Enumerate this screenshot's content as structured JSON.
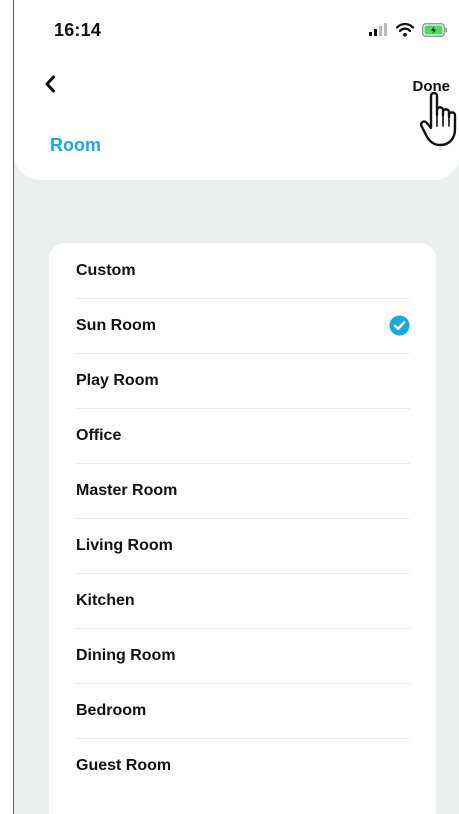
{
  "status_bar": {
    "time": "16:14",
    "icons": [
      "cellular-signal-icon",
      "wifi-icon",
      "battery-charging-icon"
    ]
  },
  "nav": {
    "back_icon": "chevron-left-icon",
    "done_label": "Done"
  },
  "page_title": "Room",
  "rooms": [
    {
      "label": "Custom",
      "selected": false
    },
    {
      "label": "Sun Room",
      "selected": true
    },
    {
      "label": "Play Room",
      "selected": false
    },
    {
      "label": "Office",
      "selected": false
    },
    {
      "label": "Master Room",
      "selected": false
    },
    {
      "label": "Living Room",
      "selected": false
    },
    {
      "label": "Kitchen",
      "selected": false
    },
    {
      "label": "Dining Room",
      "selected": false
    },
    {
      "label": "Bedroom",
      "selected": false
    },
    {
      "label": "Guest Room",
      "selected": false
    }
  ],
  "colors": {
    "accent": "#1ca8dd",
    "background": "#e9eeee",
    "battery": "#4cd964"
  }
}
